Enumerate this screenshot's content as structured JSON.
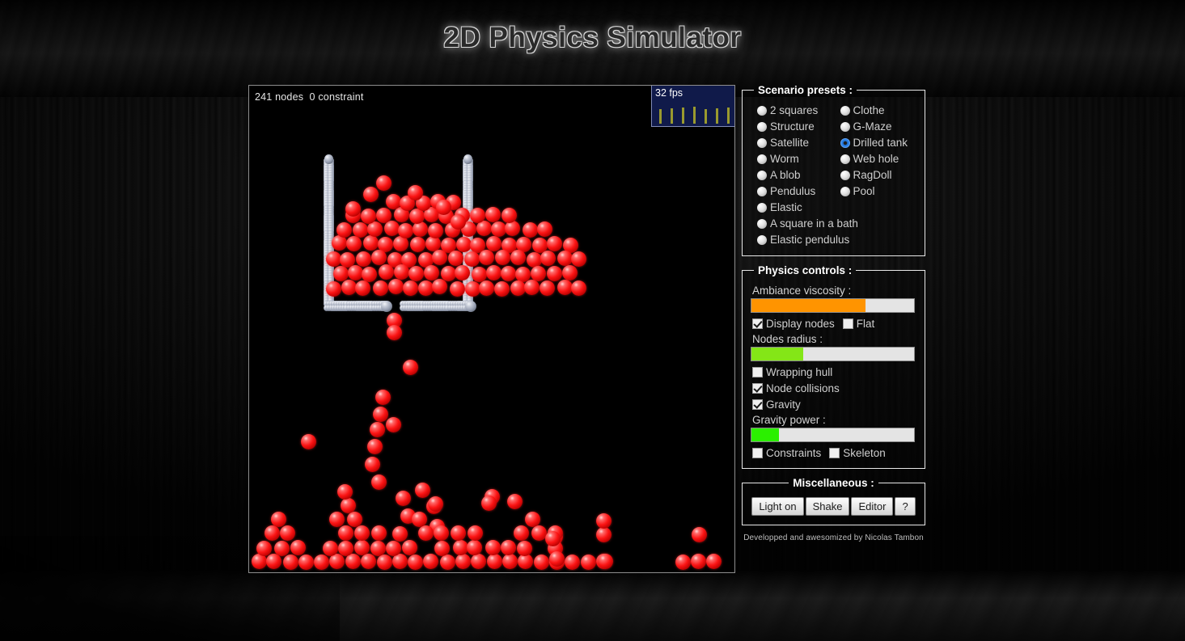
{
  "page": {
    "title": "2D Physics Simulator",
    "credits": "Developped and awesomized by Nicolas Tambon"
  },
  "simulation": {
    "stats": "241 nodes  0 constraint",
    "node_count": 241,
    "constraint_count": 0,
    "fps_label": "32 fps",
    "fps_value": 32,
    "background_color": "#000000",
    "node_color_dynamic": "#fb1414",
    "node_color_static": "#98a0b2"
  },
  "scenario_presets": {
    "legend": "Scenario presets :",
    "selected": "Drilled tank",
    "column_left": [
      {
        "label": "2 squares",
        "checked": false
      },
      {
        "label": "Structure",
        "checked": false
      },
      {
        "label": "Satellite",
        "checked": false
      },
      {
        "label": "Worm",
        "checked": false
      },
      {
        "label": "A blob",
        "checked": false
      },
      {
        "label": "Pendulus",
        "checked": false
      },
      {
        "label": "Elastic",
        "checked": false
      }
    ],
    "column_right": [
      {
        "label": "Clothe",
        "checked": false
      },
      {
        "label": "G-Maze",
        "checked": false
      },
      {
        "label": "Drilled tank",
        "checked": true
      },
      {
        "label": "Web hole",
        "checked": false
      },
      {
        "label": "RagDoll",
        "checked": false
      },
      {
        "label": "Pool",
        "checked": false
      }
    ],
    "full_width": [
      {
        "label": "A square in a bath",
        "checked": false
      },
      {
        "label": "Elastic pendulus",
        "checked": false
      }
    ]
  },
  "physics_controls": {
    "legend": "Physics controls :",
    "viscosity_label": "Ambiance viscosity :",
    "viscosity_percent": 70,
    "viscosity_color": "#ff9400",
    "display_nodes": {
      "label": "Display nodes",
      "checked": true
    },
    "flat": {
      "label": "Flat",
      "checked": false
    },
    "radius_label": "Nodes radius :",
    "radius_percent": 32,
    "radius_color": "#84e617",
    "wrapping_hull": {
      "label": "Wrapping hull",
      "checked": false
    },
    "node_collisions": {
      "label": "Node collisions",
      "checked": true
    },
    "gravity": {
      "label": "Gravity",
      "checked": true
    },
    "gravity_label": "Gravity power :",
    "gravity_percent": 17,
    "gravity_color": "#2bf000",
    "constraints": {
      "label": "Constraints",
      "checked": false
    },
    "skeleton": {
      "label": "Skeleton",
      "checked": false
    }
  },
  "miscellaneous": {
    "legend": "Miscellaneous :",
    "buttons": [
      {
        "label": "Light on"
      },
      {
        "label": "Shake"
      },
      {
        "label": "Editor"
      },
      {
        "label": "?"
      }
    ]
  }
}
